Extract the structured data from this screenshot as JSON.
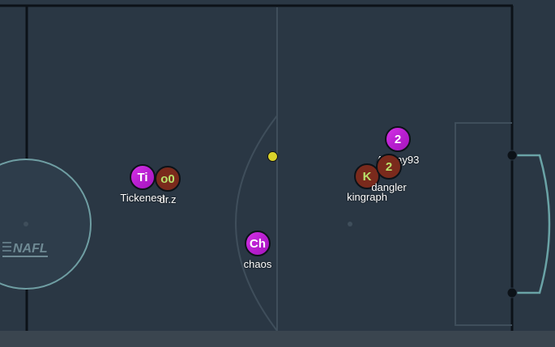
{
  "colors": {
    "field": "#2a3744",
    "line_white": "#0c1218",
    "line_soft": "#3f4e5b",
    "goal_line": "#6aa3a6",
    "red_team": "#7a2a1c",
    "blue_team": "#c829dd",
    "ball": "#d9d22a"
  },
  "logo": {
    "text": "NAFL"
  },
  "players": [
    {
      "id": "p1",
      "avatar": "Ti",
      "nick": "Tickenest",
      "team": "blue"
    },
    {
      "id": "p2",
      "avatar": "o0",
      "nick": "dr.z",
      "team": "red"
    },
    {
      "id": "p3",
      "avatar": "Ch",
      "nick": "chaos",
      "team": "blue"
    },
    {
      "id": "p4",
      "avatar": "2",
      "nick": "AJDay93",
      "team": "blue"
    },
    {
      "id": "p5",
      "avatar": "K",
      "nick": "kingraph",
      "team": "red"
    },
    {
      "id": "p6",
      "avatar": "2",
      "nick": "dangler",
      "team": "red"
    }
  ]
}
